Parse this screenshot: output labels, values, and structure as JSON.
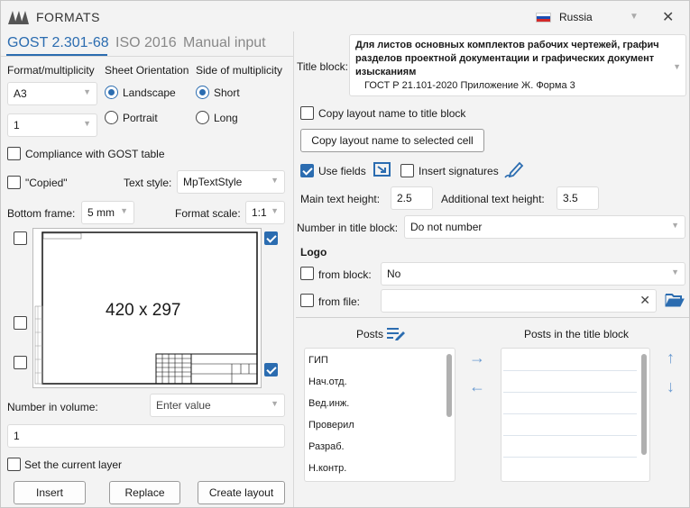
{
  "app": {
    "title": "FORMATS",
    "language": "Russia"
  },
  "tabs": [
    {
      "label": "GOST 2.301-68",
      "active": true
    },
    {
      "label": "ISO 2016",
      "active": false
    },
    {
      "label": "Manual input",
      "active": false
    }
  ],
  "left": {
    "format_label": "Format/multiplicity",
    "orientation_label": "Sheet Orientation",
    "side_label": "Side of multiplicity",
    "format_value": "A3",
    "multiplicity_value": "1",
    "orientation_options": [
      "Landscape",
      "Portrait"
    ],
    "orientation_selected": "Landscape",
    "side_options": [
      "Short",
      "Long"
    ],
    "side_selected": "Short",
    "compliance_label": "Compliance with GOST table",
    "copied_label": "\"Copied\"",
    "text_style_label": "Text style:",
    "text_style_value": "MpTextStyle",
    "bottom_frame_label": "Bottom frame:",
    "bottom_frame_value": "5 mm",
    "format_scale_label": "Format scale:",
    "format_scale_value": "1:1",
    "preview_size": "420 x 297",
    "number_in_volume_label": "Number in volume:",
    "number_in_volume_placeholder": "Enter value",
    "number_value": "1",
    "set_layer_label": "Set the current layer",
    "buttons": {
      "insert": "Insert",
      "replace": "Replace",
      "create": "Create layout"
    }
  },
  "right": {
    "title_block_label": "Title block:",
    "title_block_line1": "Для листов основных комплектов рабочих чертежей, графич",
    "title_block_line2": "разделов проектной документации и графических документ",
    "title_block_line3": "изысканиям",
    "title_block_line4": "ГОСТ Р 21.101-2020 Приложение Ж. Форма 3",
    "copy_layout_cb": "Copy layout name to title block",
    "copy_cell_btn": "Copy layout name to selected cell",
    "use_fields": "Use fields",
    "insert_signatures": "Insert signatures",
    "main_text_height_label": "Main text height:",
    "main_text_height": "2.5",
    "additional_text_height_label": "Additional text height:",
    "additional_text_height": "3.5",
    "number_in_title_block_label": "Number in title block:",
    "number_in_title_block_value": "Do not number",
    "logo_label": "Logo",
    "from_block_label": "from block:",
    "from_block_value": "No",
    "from_file_label": "from file:",
    "posts_label": "Posts",
    "posts_in_title_label": "Posts in the title block",
    "posts": [
      "ГИП",
      "Нач.отд.",
      "Вед.инж.",
      "Проверил",
      "Разраб.",
      "Н.контр."
    ]
  },
  "colors": {
    "accent": "#2b6cb0",
    "icon_blue": "#6b9bd1"
  }
}
